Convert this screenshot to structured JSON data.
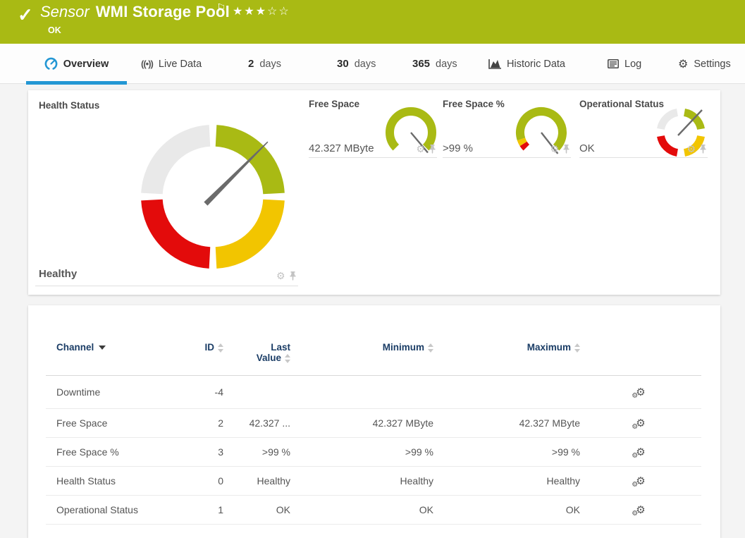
{
  "colors": {
    "header_green": "#a9ba14",
    "accent_blue": "#2397d4",
    "gauge_green": "#a9ba14",
    "gauge_yellow": "#f2c500",
    "gauge_red": "#e30b0b",
    "gauge_gray": "#e9e9e9",
    "needle_gray": "#6b6b6b",
    "table_header_navy": "#1b3d66"
  },
  "header": {
    "type_label": "Sensor",
    "title": "WMI Storage Pool",
    "status": "OK",
    "stars_filled": "★★★",
    "stars_empty": "☆☆"
  },
  "tabs": {
    "overview": "Overview",
    "live_data": "Live Data",
    "d2_num": "2",
    "d2_unit": "days",
    "d30_num": "30",
    "d30_unit": "days",
    "d365_num": "365",
    "d365_unit": "days",
    "historic": "Historic Data",
    "log": "Log",
    "settings": "Settings"
  },
  "panels": {
    "health": {
      "title": "Health Status",
      "value": "Healthy"
    },
    "free_space": {
      "title": "Free Space",
      "value": "42.327 MByte"
    },
    "free_space_pct": {
      "title": "Free Space %",
      "value": ">99 %"
    },
    "operational": {
      "title": "Operational Status",
      "value": "OK"
    }
  },
  "table": {
    "headers": {
      "channel": "Channel",
      "id": "ID",
      "last_line1": "Last",
      "last_line2": "Value",
      "minimum": "Minimum",
      "maximum": "Maximum"
    },
    "rows": [
      {
        "channel": "Downtime",
        "id": "-4",
        "last": "",
        "min": "",
        "max": ""
      },
      {
        "channel": "Free Space",
        "id": "2",
        "last": "42.327 ...",
        "min": "42.327 MByte",
        "max": "42.327 MByte"
      },
      {
        "channel": "Free Space %",
        "id": "3",
        "last": ">99 %",
        "min": ">99 %",
        "max": ">99 %"
      },
      {
        "channel": "Health Status",
        "id": "0",
        "last": "Healthy",
        "min": "Healthy",
        "max": "Healthy"
      },
      {
        "channel": "Operational Status",
        "id": "1",
        "last": "OK",
        "min": "OK",
        "max": "OK"
      }
    ]
  }
}
